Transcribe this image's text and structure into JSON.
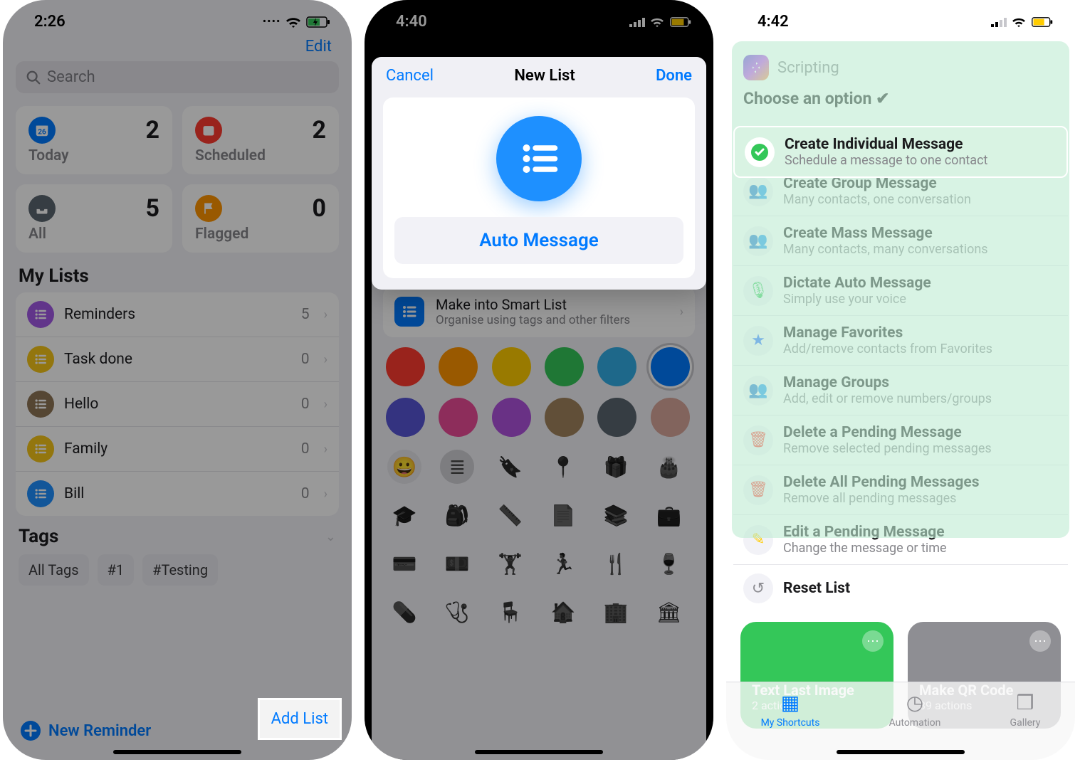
{
  "phone1": {
    "time": "2:26",
    "edit": "Edit",
    "search_placeholder": "Search",
    "cards": {
      "today": {
        "label": "Today",
        "count": "2"
      },
      "scheduled": {
        "label": "Scheduled",
        "count": "2"
      },
      "all": {
        "label": "All",
        "count": "5"
      },
      "flagged": {
        "label": "Flagged",
        "count": "0"
      }
    },
    "my_lists_title": "My Lists",
    "lists": [
      {
        "name": "Reminders",
        "count": "5",
        "color": "#a259e6"
      },
      {
        "name": "Task done",
        "count": "0",
        "color": "#f5c518"
      },
      {
        "name": "Hello",
        "count": "0",
        "color": "#8e7555"
      },
      {
        "name": "Family",
        "count": "0",
        "color": "#f5c518"
      },
      {
        "name": "Bill",
        "count": "0",
        "color": "#1e90ff"
      }
    ],
    "tags_title": "Tags",
    "tags": [
      "All Tags",
      "#1",
      "#Testing"
    ],
    "new_reminder": "New Reminder",
    "add_list": "Add List"
  },
  "phone2": {
    "time": "4:40",
    "modal": {
      "cancel": "Cancel",
      "title": "New List",
      "done": "Done"
    },
    "list_name": "Auto Message",
    "smart_list_title": "Make into Smart List",
    "smart_list_sub": "Organise using tags and other filters",
    "colors": [
      "#ff3b30",
      "#ff9500",
      "#ffcc00",
      "#34c759",
      "#32ade6",
      "#007aff",
      "#5856d6",
      "#eb4b98",
      "#af52de",
      "#a2845e",
      "#5b6770",
      "#d9a79b"
    ],
    "selected_color_index": 5
  },
  "phone3": {
    "time": "4:42",
    "scripting": "Scripting",
    "choose": "Choose an option ✔",
    "options": [
      {
        "title": "Create Individual Message",
        "sub": "Schedule a message to one contact"
      },
      {
        "title": "Create Group Message",
        "sub": "Many contacts, one conversation"
      },
      {
        "title": "Create Mass Message",
        "sub": "Many contacts, many conversations"
      },
      {
        "title": "Dictate Auto Message",
        "sub": "Simply use your voice"
      },
      {
        "title": "Manage Favorites",
        "sub": "Add/remove contacts from Favorites"
      },
      {
        "title": "Manage Groups",
        "sub": "Add, edit or remove numbers/groups"
      },
      {
        "title": "Delete a Pending Message",
        "sub": "Remove selected pending messages"
      },
      {
        "title": "Delete All Pending Messages",
        "sub": "Remove all pending messages"
      },
      {
        "title": "Edit a Pending Message",
        "sub": "Change the message or time"
      },
      {
        "title": "Reset List",
        "sub": ""
      }
    ],
    "tiles": {
      "left": {
        "title": "Text Last Image",
        "sub": "2 actions",
        "color": "#34c759"
      },
      "right": {
        "title": "Make QR Code",
        "sub": "39 actions",
        "color": "#8e8e93"
      }
    },
    "tabs": {
      "shortcuts": "My Shortcuts",
      "automation": "Automation",
      "gallery": "Gallery"
    }
  }
}
